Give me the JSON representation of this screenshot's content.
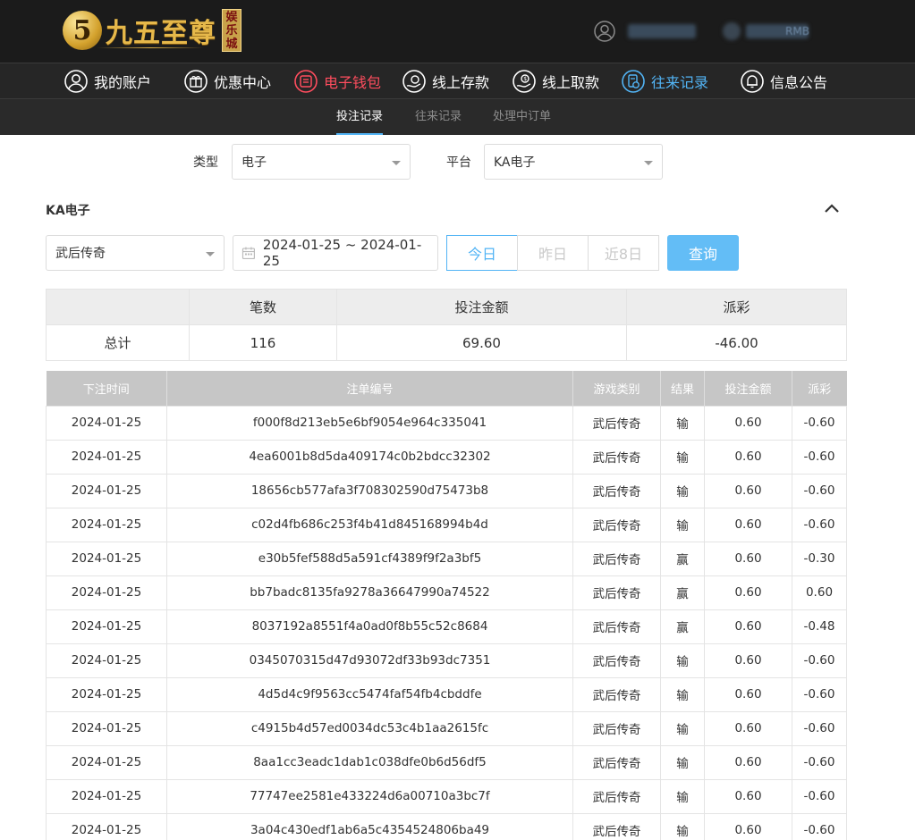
{
  "brand": {
    "logo_numeral": "5",
    "logo_text": "九五至尊",
    "logo_seal": [
      "娱",
      "乐",
      "城"
    ]
  },
  "header": {
    "balance_unit": "RMB"
  },
  "main_nav": [
    {
      "label": "我的账户",
      "icon": "user-icon"
    },
    {
      "label": "优惠中心",
      "icon": "gift-icon"
    },
    {
      "label": "电子钱包",
      "icon": "wallet-icon"
    },
    {
      "label": "线上存款",
      "icon": "deposit-icon"
    },
    {
      "label": "线上取款",
      "icon": "withdraw-icon"
    },
    {
      "label": "往来记录",
      "icon": "records-icon"
    },
    {
      "label": "信息公告",
      "icon": "bell-icon"
    }
  ],
  "sub_nav": [
    {
      "label": "投注记录",
      "active": true
    },
    {
      "label": "往来记录",
      "active": false
    },
    {
      "label": "处理中订单",
      "active": false
    }
  ],
  "filters": {
    "type_label": "类型",
    "type_value": "电子",
    "platform_label": "平台",
    "platform_value": "KA电子",
    "section_title": "KA电子",
    "game_value": "武后传奇",
    "date_range": "2024-01-25 ~ 2024-01-25",
    "range_buttons": [
      "今日",
      "昨日",
      "近8日"
    ],
    "active_range": "今日",
    "query_label": "查询"
  },
  "summary": {
    "headers": [
      "",
      "笔数",
      "投注金额",
      "派彩"
    ],
    "row": {
      "label": "总计",
      "count": "116",
      "bet_amount": "69.60",
      "payout": "-46.00"
    }
  },
  "detail": {
    "headers": [
      "下注时间",
      "注单编号",
      "游戏类别",
      "结果",
      "投注金额",
      "派彩"
    ],
    "rows": [
      [
        "2024-01-25",
        "f000f8d213eb5e6bf9054e964c335041",
        "武后传奇",
        "输",
        "0.60",
        "-0.60"
      ],
      [
        "2024-01-25",
        "4ea6001b8d5da409174c0b2bdcc32302",
        "武后传奇",
        "输",
        "0.60",
        "-0.60"
      ],
      [
        "2024-01-25",
        "18656cb577afa3f708302590d75473b8",
        "武后传奇",
        "输",
        "0.60",
        "-0.60"
      ],
      [
        "2024-01-25",
        "c02d4fb686c253f4b41d845168994b4d",
        "武后传奇",
        "输",
        "0.60",
        "-0.60"
      ],
      [
        "2024-01-25",
        "e30b5fef588d5a591cf4389f9f2a3bf5",
        "武后传奇",
        "赢",
        "0.60",
        "-0.30"
      ],
      [
        "2024-01-25",
        "bb7badc8135fa9278a36647990a74522",
        "武后传奇",
        "赢",
        "0.60",
        "0.60"
      ],
      [
        "2024-01-25",
        "8037192a8551f4a0ad0f8b55c52c8684",
        "武后传奇",
        "赢",
        "0.60",
        "-0.48"
      ],
      [
        "2024-01-25",
        "0345070315d47d93072df33b93dc7351",
        "武后传奇",
        "输",
        "0.60",
        "-0.60"
      ],
      [
        "2024-01-25",
        "4d5d4c9f9563cc5474faf54fb4cbddfe",
        "武后传奇",
        "输",
        "0.60",
        "-0.60"
      ],
      [
        "2024-01-25",
        "c4915b4d57ed0034dc53c4b1aa2615fc",
        "武后传奇",
        "输",
        "0.60",
        "-0.60"
      ],
      [
        "2024-01-25",
        "8aa1cc3eadc1dab1c038dfe0b6d56df5",
        "武后传奇",
        "输",
        "0.60",
        "-0.60"
      ],
      [
        "2024-01-25",
        "77747ee2581e433224d6a00710a3bc7f",
        "武后传奇",
        "输",
        "0.60",
        "-0.60"
      ],
      [
        "2024-01-25",
        "3a04c430edf1ab6a5c4354524806ba49",
        "武后传奇",
        "输",
        "0.60",
        "-0.60"
      ]
    ]
  },
  "colors": {
    "header_bg": "#1b1b1b",
    "accent_blue": "#52b4f5",
    "wallet_red": "#ff4d5e",
    "negative_red": "#e8484f",
    "logo_gold": "#e6b84a"
  }
}
